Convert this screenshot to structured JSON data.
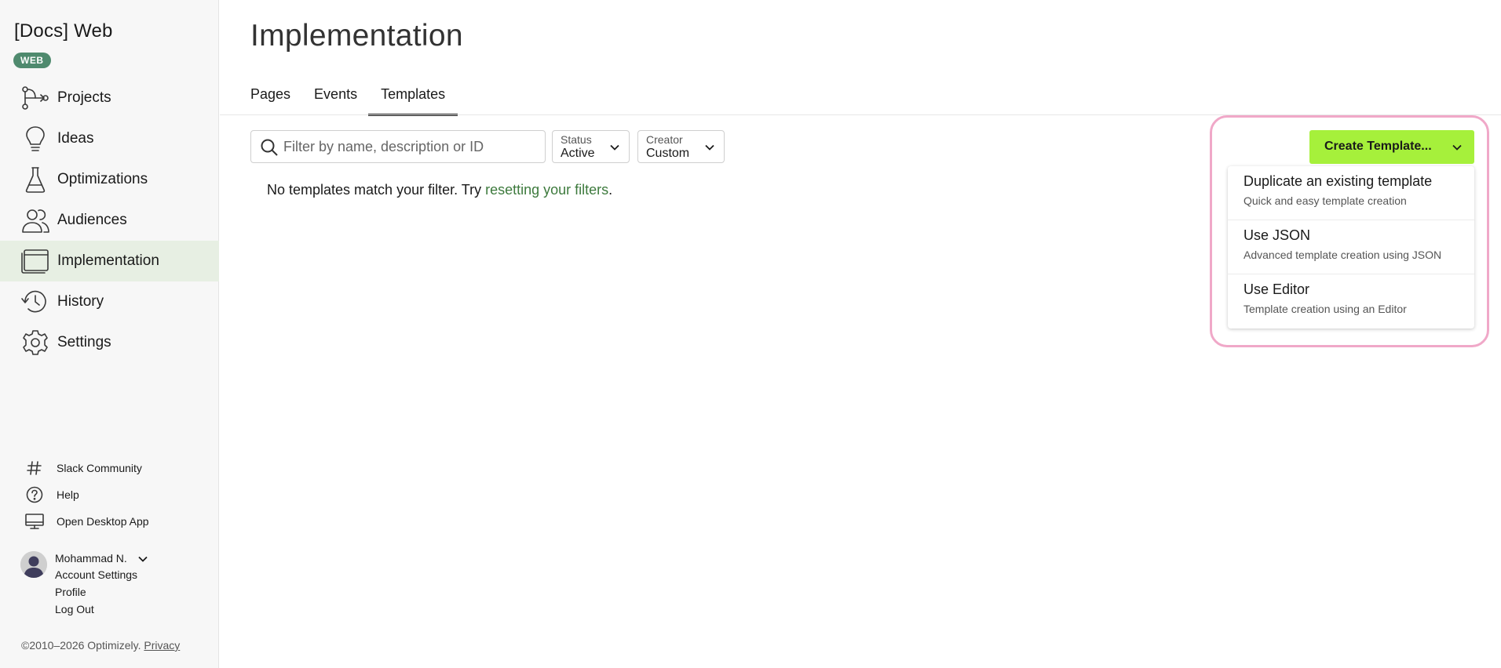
{
  "sidebar": {
    "brand": "[Docs] Web",
    "badge": "WEB",
    "nav": [
      {
        "label": "Projects",
        "icon": "projects-icon"
      },
      {
        "label": "Ideas",
        "icon": "lightbulb-icon"
      },
      {
        "label": "Optimizations",
        "icon": "flask-icon"
      },
      {
        "label": "Audiences",
        "icon": "people-icon"
      },
      {
        "label": "Implementation",
        "icon": "window-icon",
        "active": true
      },
      {
        "label": "History",
        "icon": "history-icon"
      },
      {
        "label": "Settings",
        "icon": "gear-icon"
      }
    ],
    "utility": [
      {
        "label": "Slack Community",
        "icon": "hash-icon"
      },
      {
        "label": "Help",
        "icon": "question-icon"
      },
      {
        "label": "Open Desktop App",
        "icon": "desktop-icon"
      }
    ],
    "user": {
      "name": "Mohammad N.",
      "links": [
        "Account Settings",
        "Profile",
        "Log Out"
      ]
    },
    "footer": {
      "copyright": "©2010–2026 Optimizely.",
      "privacy": "Privacy"
    }
  },
  "main": {
    "title": "Implementation",
    "tabs": [
      {
        "label": "Pages"
      },
      {
        "label": "Events"
      },
      {
        "label": "Templates",
        "active": true
      }
    ],
    "search": {
      "placeholder": "Filter by name, description or ID",
      "value": ""
    },
    "filters": {
      "status": {
        "label": "Status",
        "value": "Active"
      },
      "creator": {
        "label": "Creator",
        "value": "Custom"
      }
    },
    "empty": {
      "prefix": "No templates match your filter. Try ",
      "link": "resetting your filters",
      "suffix": "."
    },
    "create": {
      "label": "Create Template...",
      "menu": [
        {
          "title": "Duplicate an existing template",
          "desc": "Quick and easy template creation"
        },
        {
          "title": "Use JSON",
          "desc": "Advanced template creation using JSON"
        },
        {
          "title": "Use Editor",
          "desc": "Template creation using an Editor"
        }
      ]
    }
  },
  "colors": {
    "accent": "#a6f03b",
    "badge": "#4f8a6e",
    "link": "#3d7a3d",
    "active_nav": "#e7efe3",
    "highlight": "#f0a8c8"
  }
}
